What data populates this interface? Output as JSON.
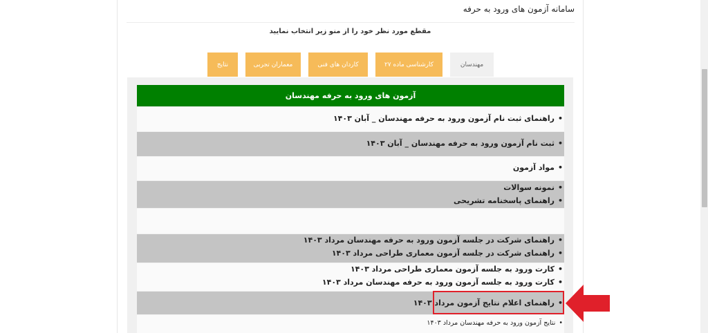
{
  "site_title": "سامانه آزمون های ورود به حرفه",
  "instruction": "مقطع مورد نظر خود را از منو زیر انتخاب نمایید",
  "tabs": [
    {
      "label": "نتایج"
    },
    {
      "label": "معماران تجربی"
    },
    {
      "label": "کاردان های فنی"
    },
    {
      "label": "کارشناسی ماده ۲۷"
    },
    {
      "label": "مهندسان"
    }
  ],
  "panel": {
    "header": "آزمون های ورود به حرفه مهندسان",
    "items": [
      "راهنمای ثبت نام آزمون ورود به حرفه مهندسان _ آبان ۱۴۰۳",
      "ثبت نام آزمون ورود به حرفه مهندسان _ آبان ۱۴۰۳",
      "مواد آزمون",
      "نمونه سوالات",
      "راهنمای پاسخنامه تشریحی",
      "راهنمای شرکت در جلسه آزمون ورود به حرفه مهندسان مرداد ۱۴۰۳",
      "راهنمای شرکت در جلسه آزمون معماری طراحی  مرداد ۱۴۰۳",
      "کارت ورود به جلسه آزمون معماری طراحی مرداد ۱۴۰۳",
      "کارت ورود به جلسه آزمون ورود به حرفه مهندسان مرداد ۱۴۰۳",
      "راهنمای اعلام نتایج آزمون مرداد ۱۴۰۳",
      "نتایج آزمون ورود به حرفه مهندسان مرداد ۱۴۰۳"
    ]
  },
  "colors": {
    "header_green": "#008000",
    "tab_orange": "#f6bb59",
    "row_gray": "#c4c4c4",
    "highlight_red": "#e0202a"
  }
}
